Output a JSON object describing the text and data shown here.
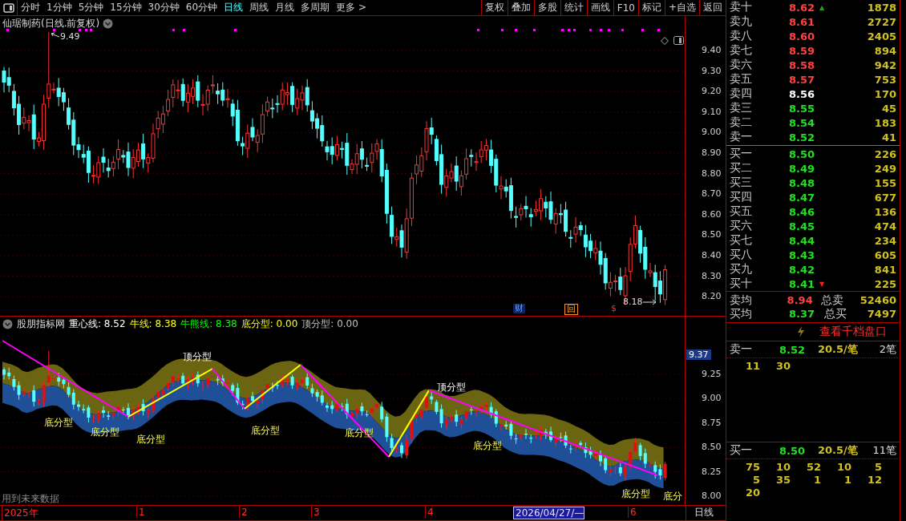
{
  "toolbar": {
    "periods": [
      {
        "label": "分时",
        "selected": false
      },
      {
        "label": "1分钟",
        "selected": false
      },
      {
        "label": "5分钟",
        "selected": false
      },
      {
        "label": "15分钟",
        "selected": false
      },
      {
        "label": "30分钟",
        "selected": false
      },
      {
        "label": "60分钟",
        "selected": false
      },
      {
        "label": "日线",
        "selected": true
      },
      {
        "label": "周线",
        "selected": false
      },
      {
        "label": "月线",
        "selected": false
      },
      {
        "label": "多周期",
        "selected": false
      },
      {
        "label": "更多 >",
        "selected": false
      }
    ],
    "actions": [
      "复权",
      "叠加",
      "多股",
      "统计",
      "画线",
      "F10",
      "标记",
      "+自选",
      "返回"
    ]
  },
  "main_chart": {
    "title": "仙琚制药(日线.前复权)",
    "high_label": "9.49",
    "low_label": "8.18",
    "yticks": [
      "9.40",
      "9.30",
      "9.20",
      "9.10",
      "9.00",
      "8.90",
      "8.80",
      "8.70",
      "8.60",
      "8.50",
      "8.40",
      "8.30",
      "8.20"
    ],
    "event_marks": [
      {
        "kind": "finance",
        "label": "财"
      },
      {
        "kind": "buyback",
        "label": "回"
      },
      {
        "kind": "dividend",
        "label": "$"
      }
    ]
  },
  "indicator": {
    "name": "股朋指标网",
    "legend": [
      {
        "text": "重心线: 8.52",
        "color": "#ffffff"
      },
      {
        "text": "牛线: 8.38",
        "color": "#ffff00"
      },
      {
        "text": "牛熊线: 8.38",
        "color": "#00ff00"
      },
      {
        "text": "底分型: 0.00",
        "color": "#ffff00"
      },
      {
        "text": "顶分型: 0.00",
        "color": "#c0c0c0"
      }
    ],
    "current_value": "9.37",
    "yticks": [
      "9.25",
      "9.00",
      "8.75",
      "8.50",
      "8.25",
      "8.00"
    ],
    "patterns": [
      {
        "kind": "top",
        "label": "顶分型"
      },
      {
        "kind": "top",
        "label": "顶分型"
      },
      {
        "kind": "bottom",
        "label": "底分型"
      },
      {
        "kind": "bottom",
        "label": "底分型"
      },
      {
        "kind": "bottom",
        "label": "底分型"
      },
      {
        "kind": "bottom",
        "label": "底分型"
      },
      {
        "kind": "bottom",
        "label": "底分型"
      },
      {
        "kind": "bottom",
        "label": "底分型"
      },
      {
        "kind": "bottom",
        "label": "底分型"
      },
      {
        "kind": "bottom",
        "label": "底分"
      }
    ],
    "note": "用到未来数据"
  },
  "time_axis": {
    "labels": [
      {
        "label": "2025年",
        "selected": false
      },
      {
        "label": "1",
        "selected": false
      },
      {
        "label": "2",
        "selected": false
      },
      {
        "label": "3",
        "selected": false
      },
      {
        "label": "4",
        "selected": false
      },
      {
        "label": "2026/04/27/—",
        "selected": true
      },
      {
        "label": "6",
        "selected": false
      }
    ],
    "period": "日线"
  },
  "order_book": {
    "asks": [
      {
        "label": "卖十",
        "price": "8.62",
        "color": "#ff4040",
        "volume": "1878",
        "arrow": "▲"
      },
      {
        "label": "卖九",
        "price": "8.61",
        "color": "#ff4040",
        "volume": "2727"
      },
      {
        "label": "卖八",
        "price": "8.60",
        "color": "#ff4040",
        "volume": "2405"
      },
      {
        "label": "卖七",
        "price": "8.59",
        "color": "#ff4040",
        "volume": "894"
      },
      {
        "label": "卖六",
        "price": "8.58",
        "color": "#ff4040",
        "volume": "942"
      },
      {
        "label": "卖五",
        "price": "8.57",
        "color": "#ff4040",
        "volume": "753"
      },
      {
        "label": "卖四",
        "price": "8.56",
        "color": "#ffffff",
        "volume": "170"
      },
      {
        "label": "卖三",
        "price": "8.55",
        "color": "#20e020",
        "volume": "45"
      },
      {
        "label": "卖二",
        "price": "8.54",
        "color": "#20e020",
        "volume": "183"
      },
      {
        "label": "卖一",
        "price": "8.52",
        "color": "#20e020",
        "volume": "41"
      }
    ],
    "bids": [
      {
        "label": "买一",
        "price": "8.50",
        "color": "#20e020",
        "volume": "226"
      },
      {
        "label": "买二",
        "price": "8.49",
        "color": "#20e020",
        "volume": "249"
      },
      {
        "label": "买三",
        "price": "8.48",
        "color": "#20e020",
        "volume": "155"
      },
      {
        "label": "买四",
        "price": "8.47",
        "color": "#20e020",
        "volume": "677"
      },
      {
        "label": "买五",
        "price": "8.46",
        "color": "#20e020",
        "volume": "136"
      },
      {
        "label": "买六",
        "price": "8.45",
        "color": "#20e020",
        "volume": "474"
      },
      {
        "label": "买七",
        "price": "8.44",
        "color": "#20e020",
        "volume": "234"
      },
      {
        "label": "买八",
        "price": "8.43",
        "color": "#20e020",
        "volume": "605"
      },
      {
        "label": "买九",
        "price": "8.42",
        "color": "#20e020",
        "volume": "841"
      },
      {
        "label": "买十",
        "price": "8.41",
        "color": "#20e020",
        "volume": "225",
        "arrow": "▼"
      }
    ],
    "summary": [
      {
        "label": "卖均",
        "price": "8.94",
        "color": "#ff4040",
        "total_label": "总卖",
        "total": "52460"
      },
      {
        "label": "买均",
        "price": "8.37",
        "color": "#20e020",
        "total_label": "总买",
        "total": "7497"
      }
    ],
    "depth_link": "查看千档盘口",
    "queues": [
      {
        "label": "卖一",
        "price": "8.52",
        "color": "#20e020",
        "avg": "20.5/笔",
        "count": "2笔",
        "orders": [
          "11",
          "30"
        ]
      },
      {
        "label": "买一",
        "price": "8.50",
        "color": "#20e020",
        "avg": "20.5/笔",
        "count": "11笔",
        "orders": [
          "75",
          "10",
          "52",
          "10",
          "5",
          "5",
          "35",
          "1",
          "1",
          "12",
          "20"
        ]
      }
    ]
  }
}
